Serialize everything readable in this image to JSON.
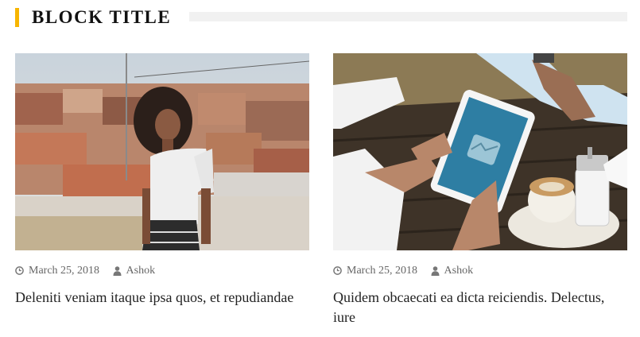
{
  "block": {
    "title": "BLOCK TITLE"
  },
  "posts": [
    {
      "date": "March 25, 2018",
      "author": "Ashok",
      "title": "Deleniti veniam itaque ipsa quos, et repudiandae",
      "image_alt": "woman-on-rooftop-photo"
    },
    {
      "date": "March 25, 2018",
      "author": "Ashok",
      "title": "Quidem obcaecati ea dicta reiciendis. Delectus, iure",
      "image_alt": "tablet-and-coffee-photo"
    }
  ],
  "colors": {
    "accent": "#f7b500",
    "meta": "#666666",
    "headline": "#222222"
  },
  "icons": {
    "date": "clock-icon",
    "author": "user-icon"
  }
}
